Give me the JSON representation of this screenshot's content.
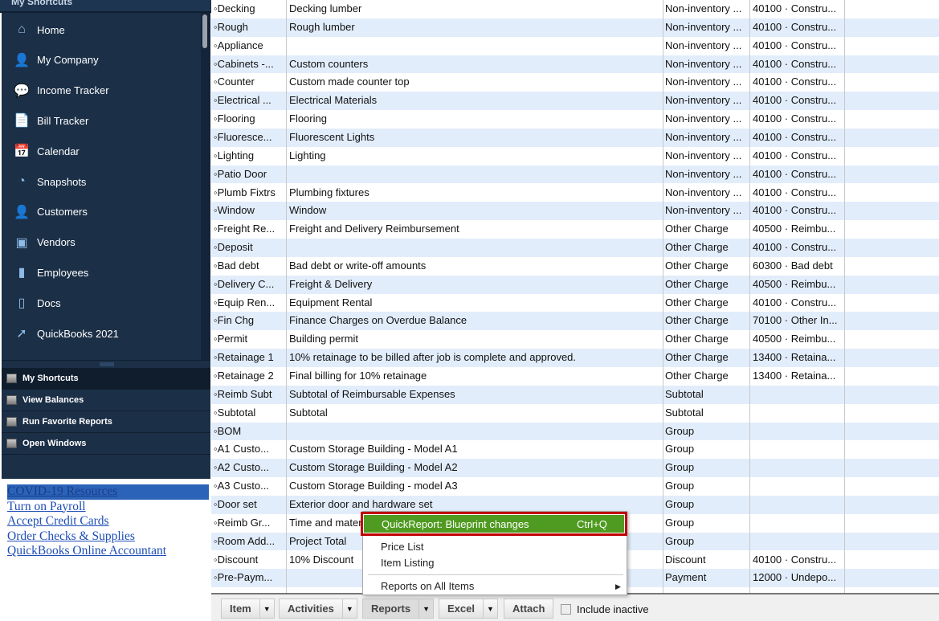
{
  "sidebar": {
    "header": "My Shortcuts",
    "items": [
      {
        "label": "Home",
        "icon": "home-icon"
      },
      {
        "label": "My Company",
        "icon": "company-icon"
      },
      {
        "label": "Income Tracker",
        "icon": "income-tracker-icon"
      },
      {
        "label": "Bill Tracker",
        "icon": "bill-tracker-icon"
      },
      {
        "label": "Calendar",
        "icon": "calendar-icon"
      },
      {
        "label": "Snapshots",
        "icon": "pie-chart-icon"
      },
      {
        "label": "Customers",
        "icon": "customer-icon"
      },
      {
        "label": "Vendors",
        "icon": "vendor-icon"
      },
      {
        "label": "Employees",
        "icon": "employee-icon"
      },
      {
        "label": "Docs",
        "icon": "document-icon"
      },
      {
        "label": "QuickBooks 2021",
        "icon": "upgrade-arrow-icon"
      }
    ],
    "panels": [
      {
        "label": "My Shortcuts",
        "selected": true
      },
      {
        "label": "View Balances"
      },
      {
        "label": "Run Favorite Reports"
      },
      {
        "label": "Open Windows"
      }
    ],
    "links": [
      "COVID-19 Resources",
      "Turn on Payroll",
      "Accept Credit Cards",
      "Order Checks & Supplies",
      "QuickBooks Online Accountant"
    ]
  },
  "items": [
    [
      "◦Decking",
      "Decking lumber",
      "Non-inventory ...",
      "40100 · Constru..."
    ],
    [
      "◦Rough",
      "Rough lumber",
      "Non-inventory ...",
      "40100 · Constru..."
    ],
    [
      "◦Appliance",
      "",
      "Non-inventory ...",
      "40100 · Constru..."
    ],
    [
      "◦Cabinets -...",
      "Custom counters",
      "Non-inventory ...",
      "40100 · Constru..."
    ],
    [
      "◦Counter",
      "Custom made counter top",
      "Non-inventory ...",
      "40100 · Constru..."
    ],
    [
      "◦Electrical ...",
      "Electrical Materials",
      "Non-inventory ...",
      "40100 · Constru..."
    ],
    [
      "◦Flooring",
      "Flooring",
      "Non-inventory ...",
      "40100 · Constru..."
    ],
    [
      "◦Fluoresce...",
      "Fluorescent Lights",
      "Non-inventory ...",
      "40100 · Constru..."
    ],
    [
      "◦Lighting",
      "Lighting",
      "Non-inventory ...",
      "40100 · Constru..."
    ],
    [
      "◦Patio Door",
      "",
      "Non-inventory ...",
      "40100 · Constru..."
    ],
    [
      "◦Plumb Fixtrs",
      "Plumbing fixtures",
      "Non-inventory ...",
      "40100 · Constru..."
    ],
    [
      "◦Window",
      "Window",
      "Non-inventory ...",
      "40100 · Constru..."
    ],
    [
      "◦Freight Re...",
      "Freight and Delivery Reimbursement",
      "Other Charge",
      "40500 · Reimbu..."
    ],
    [
      "◦Deposit",
      "",
      "Other Charge",
      "40100 · Constru..."
    ],
    [
      "◦Bad debt",
      "Bad debt or write-off amounts",
      "Other Charge",
      "60300 · Bad debt"
    ],
    [
      "◦Delivery C...",
      "Freight & Delivery",
      "Other Charge",
      "40500 · Reimbu..."
    ],
    [
      "◦Equip Ren...",
      "Equipment Rental",
      "Other Charge",
      "40100 · Constru..."
    ],
    [
      "◦Fin Chg",
      "Finance Charges on Overdue Balance",
      "Other Charge",
      "70100 · Other In..."
    ],
    [
      "◦Permit",
      "Building permit",
      "Other Charge",
      "40500 · Reimbu..."
    ],
    [
      "◦Retainage 1",
      "10% retainage to be billed after job is complete and approved.",
      "Other Charge",
      "13400 · Retaina..."
    ],
    [
      "◦Retainage 2",
      "Final billing for 10% retainage",
      "Other Charge",
      "13400 · Retaina..."
    ],
    [
      "◦Reimb Subt",
      "Subtotal of Reimbursable Expenses",
      "Subtotal",
      ""
    ],
    [
      "◦Subtotal",
      "Subtotal",
      "Subtotal",
      ""
    ],
    [
      "◦BOM",
      "",
      "Group",
      ""
    ],
    [
      "◦A1 Custo...",
      "Custom Storage Building - Model A1",
      "Group",
      ""
    ],
    [
      "◦A2 Custo...",
      "Custom Storage Building - Model A2",
      "Group",
      ""
    ],
    [
      "◦A3 Custo...",
      "Custom Storage Building - model A3",
      "Group",
      ""
    ],
    [
      "◦Door set",
      "Exterior door and hardware set",
      "Group",
      ""
    ],
    [
      "◦Reimb Gr...",
      "Time and materials",
      "Group",
      ""
    ],
    [
      "◦Room Add...",
      "Project Total",
      "Group",
      ""
    ],
    [
      "◦Discount",
      "10% Discount",
      "Discount",
      "40100 · Constru..."
    ],
    [
      "◦Pre-Paym...",
      "",
      "Payment",
      "12000 · Undepo..."
    ]
  ],
  "toolbar": {
    "item": "Item",
    "activities": "Activities",
    "reports": "Reports",
    "excel": "Excel",
    "attach": "Attach",
    "include_inactive": "Include inactive",
    "include_inactive_checked": false
  },
  "menu": {
    "quickreport": "QuickReport: Blueprint changes",
    "quickreport_shortcut": "Ctrl+Q",
    "price_list": "Price List",
    "item_listing": "Item Listing",
    "reports_all": "Reports on All Items"
  },
  "colors": {
    "sidebar": "#1b2f47",
    "row_alt": "#e2edfb",
    "menu_highlight": "#4f9a20",
    "highlight_border": "#c00000"
  }
}
